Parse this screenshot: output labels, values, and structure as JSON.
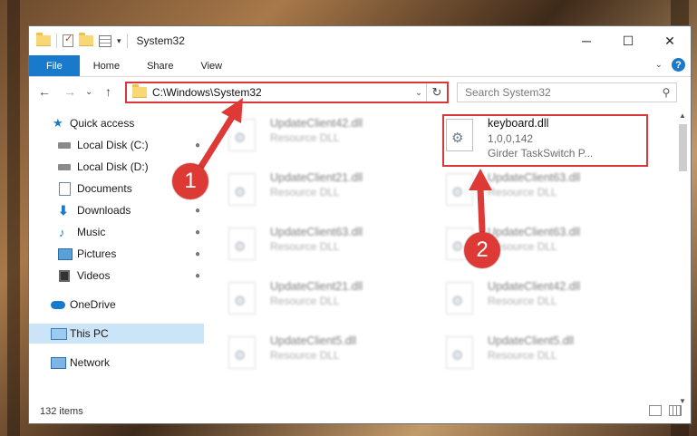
{
  "window": {
    "title": "System32",
    "controls": [
      "─",
      "☐",
      "✕"
    ]
  },
  "quick_toolbar": {
    "dropdown": "▾"
  },
  "ribbon": {
    "tabs": [
      "File",
      "Home",
      "Share",
      "View"
    ],
    "collapse": "⌄",
    "help": "?"
  },
  "nav": {
    "back": "←",
    "forward": "→",
    "recent": "⌄",
    "up": "↑",
    "address": "C:\\Windows\\System32",
    "address_dropdown": "⌄",
    "refresh": "↻",
    "search_placeholder": "Search System32",
    "search_icon": "⚲"
  },
  "sidebar": {
    "items": [
      {
        "label": "Quick access",
        "icon": "star-icon",
        "pinned": false
      },
      {
        "label": "Local Disk (C:)",
        "icon": "drive-icon",
        "pinned": true
      },
      {
        "label": "Local Disk (D:)",
        "icon": "drive-icon",
        "pinned": false
      },
      {
        "label": "Documents",
        "icon": "documents-icon",
        "pinned": true
      },
      {
        "label": "Downloads",
        "icon": "downloads-icon",
        "pinned": true
      },
      {
        "label": "Music",
        "icon": "music-icon",
        "pinned": true
      },
      {
        "label": "Pictures",
        "icon": "pictures-icon",
        "pinned": true
      },
      {
        "label": "Videos",
        "icon": "videos-icon",
        "pinned": true
      },
      {
        "label": "OneDrive",
        "icon": "onedrive-icon",
        "pinned": false
      },
      {
        "label": "This PC",
        "icon": "pc-icon",
        "pinned": false,
        "selected": true
      },
      {
        "label": "Network",
        "icon": "network-icon",
        "pinned": false
      }
    ],
    "pin_glyph": "📌"
  },
  "files": [
    {
      "name": "UpdateClient42.dll",
      "type": "Resource DLL",
      "blurred": true
    },
    {
      "name": "keyboard.dll",
      "version": "1,0,0,142",
      "description": "Girder TaskSwitch P...",
      "blurred": false,
      "highlighted": true
    },
    {
      "name": "UpdateClient21.dll",
      "type": "Resource DLL",
      "blurred": true
    },
    {
      "name": "UpdateClient63.dll",
      "type": "Resource DLL",
      "blurred": true
    },
    {
      "name": "UpdateClient63.dll",
      "type": "Resource DLL",
      "blurred": true
    },
    {
      "name": "UpdateClient63.dll",
      "type": "Resource DLL",
      "blurred": true
    },
    {
      "name": "UpdateClient21.dll",
      "type": "Resource DLL",
      "blurred": true
    },
    {
      "name": "UpdateClient42.dll",
      "type": "Resource DLL",
      "blurred": true
    },
    {
      "name": "UpdateClient5.dll",
      "type": "Resource DLL",
      "blurred": true
    },
    {
      "name": "UpdateClient5.dll",
      "type": "Resource DLL",
      "blurred": true
    }
  ],
  "status": {
    "item_count": "132 items"
  },
  "annotations": [
    {
      "number": "1",
      "color": "#dd3a36"
    },
    {
      "number": "2",
      "color": "#dd3a36"
    }
  ],
  "colors": {
    "accent": "#1979ca",
    "highlight": "#d9383b",
    "selected_bg": "#cce4f7"
  }
}
